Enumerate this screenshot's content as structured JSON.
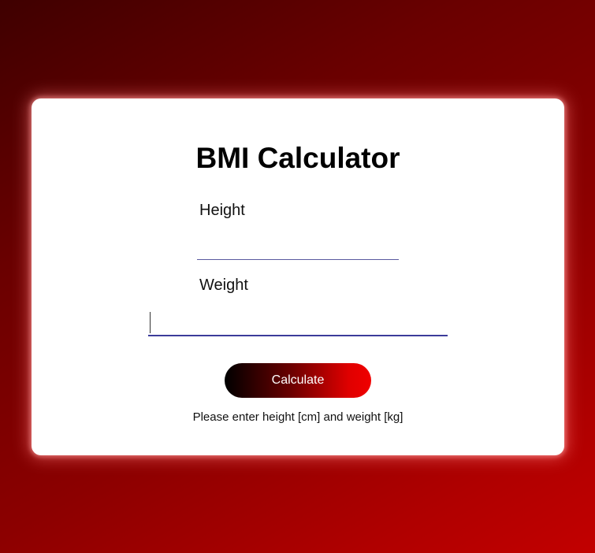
{
  "app": {
    "title": "BMI Calculator"
  },
  "form": {
    "height_label": "Height",
    "height_value": "",
    "weight_label": "Weight",
    "weight_value": ""
  },
  "actions": {
    "calculate_label": "Calculate"
  },
  "status": {
    "message": "Please enter height [cm] and weight [kg]"
  },
  "colors": {
    "background_dark": "#3f0000",
    "background_bright": "#c20000",
    "card": "#ffffff",
    "input_underline": "#3c3c9a",
    "button_start": "#000000",
    "button_end": "#f00000",
    "button_text": "#ffffff"
  }
}
